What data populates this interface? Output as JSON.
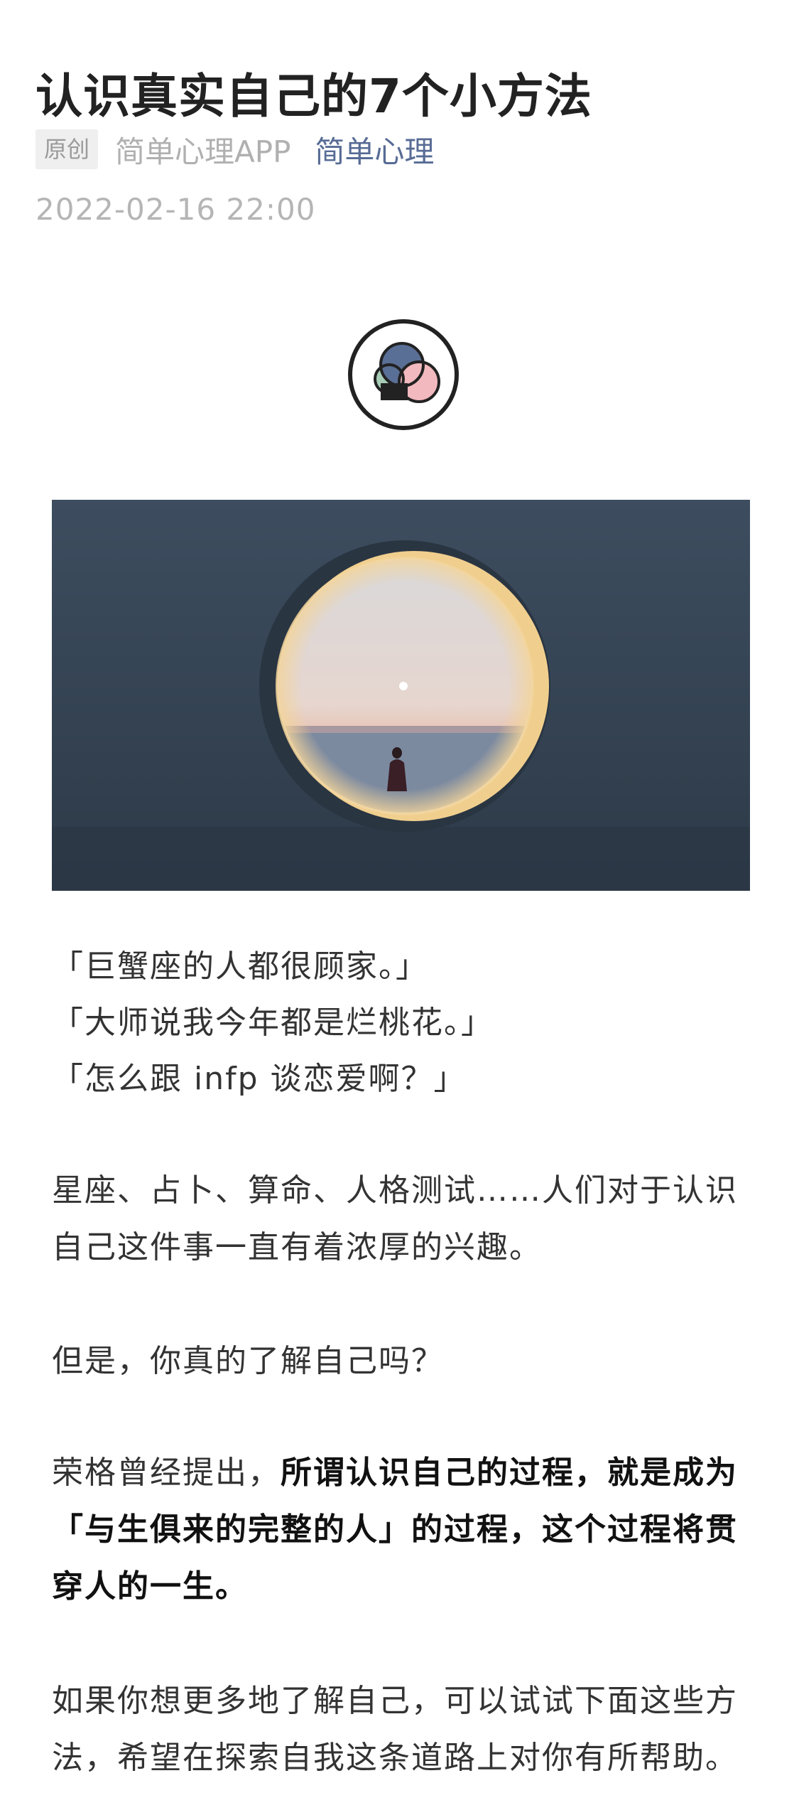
{
  "article": {
    "title": "认识真实自己的7个小方法",
    "badge": "原创",
    "source": "简单心理APP",
    "account": "简单心理",
    "date": "2022-02-16 22:00"
  },
  "content": {
    "quotes": [
      "「巨蟹座的人都很顾家。」",
      "「大师说我今年都是烂桃花。」",
      "「怎么跟 infp 谈恋爱啊？」"
    ],
    "para1": "星座、占卜、算命、人格测试……人们对于认识自己这件事一直有着浓厚的兴趣。",
    "para2": "但是，你真的了解自己吗？",
    "para3_prefix": "荣格曾经提出，",
    "para3_bold": "所谓认识自己的过程，就是成为「与生俱来的完整的人」的过程，这个过程将贯穿人的一生。",
    "para4": "如果你想更多地了解自己，可以试试下面这些方法，希望在探索自我这条道路上对你有所帮助。"
  },
  "colors": {
    "accent": "#576b95",
    "logo_blue": "#5a6f96",
    "logo_pink": "#f2b9be",
    "logo_green": "#a8cdb7",
    "hero_bg": "#364454"
  }
}
